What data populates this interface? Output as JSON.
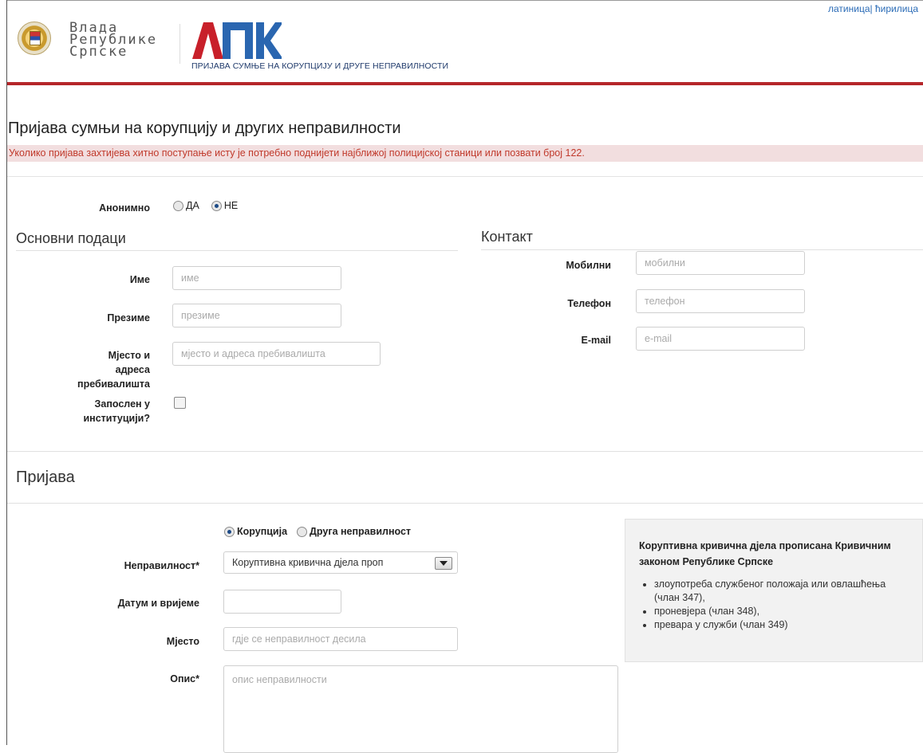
{
  "header": {
    "lang_latin": "латиница",
    "lang_separator": "|",
    "lang_cyrillic": "ћирилица",
    "gov_name_lines": [
      "Влада",
      "Републике",
      "Српске"
    ],
    "apk_logo_text": "АПК",
    "apk_subtitle": "ПРИЈАВА СУМЊЕ НА КОРУПЦИЈУ И ДРУГЕ НЕПРАВИЛНОСТИ",
    "accent_color": "#b5262a",
    "logo_blue": "#2a66b0"
  },
  "page": {
    "title": "Пријава сумњи на корупцију и других неправилности",
    "alert": "Уколико пријава захтијева хитно поступање исту је потребно поднијети најближој полицијској станици или позвати број 122."
  },
  "anonymous": {
    "label": "Анонимно",
    "options": [
      "ДА",
      "НЕ"
    ],
    "selected": "НЕ"
  },
  "basic": {
    "title": "Основни подаци",
    "name_label": "Име",
    "name_placeholder": "име",
    "surname_label": "Презиме",
    "surname_placeholder": "презиме",
    "address_label_1": "Мјесто и",
    "address_label_2": "адреса пребивалишта",
    "address_placeholder": "мјесто и адреса пребивалишта",
    "employed_label_1": "Запослен у",
    "employed_label_2": "институцији?",
    "employed_checked": false
  },
  "contact": {
    "title": "Контакт",
    "mobile_label": "Мобилни",
    "mobile_placeholder": "мобилни",
    "phone_label": "Телефон",
    "phone_placeholder": "телефон",
    "email_label": "E-mail",
    "email_placeholder": "e-mail"
  },
  "report": {
    "title": "Пријава",
    "type_options": [
      "Корупција",
      "Друга неправилност"
    ],
    "type_selected": "Корупција",
    "irregularity_label": "Неправилност*",
    "irregularity_value": "Коруптивна кривична дјела проп",
    "datetime_label": "Датум и вријеме",
    "datetime_value": "",
    "place_label": "Мјесто",
    "place_placeholder": "гдје се неправилност десила",
    "description_label": "Опис*",
    "description_placeholder": "опис неправилности"
  },
  "info": {
    "title": "Коруптивна кривична дјела прописана Кривичним законом Републике Српске",
    "items": [
      "злоупотреба службеног положаја или овлашћења (члан 347),",
      "проневјера (члан 348),",
      "превара у служби (члан 349)"
    ]
  }
}
